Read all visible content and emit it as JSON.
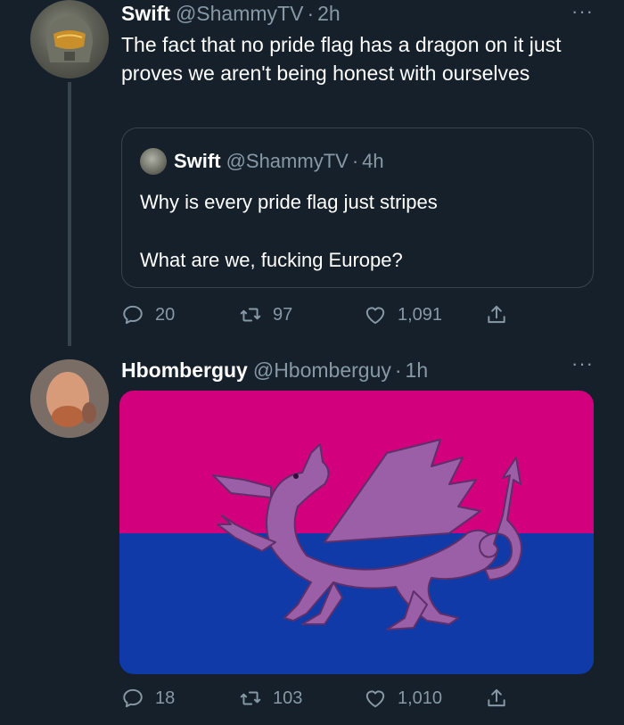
{
  "colors": {
    "background": "#15202b",
    "text": "#ffffff",
    "muted": "#8899a6",
    "border": "#38444d",
    "flag_pink": "#d3007e",
    "flag_blue": "#0f3aa8",
    "dragon_purple": "#9b5fa8"
  },
  "tweet1": {
    "name": "Swift",
    "handle": "@ShammyTV",
    "separator": "·",
    "time": "2h",
    "more": "···",
    "text": "The fact that no pride flag has a dragon on it just proves we aren't being honest with ourselves",
    "quote": {
      "name": "Swift",
      "handle": "@ShammyTV",
      "separator": "·",
      "time": "4h",
      "line1": "Why is every pride flag just stripes",
      "line2": "What are we, fucking Europe?"
    },
    "actions": {
      "replies": "20",
      "retweets": "97",
      "likes": "1,091"
    }
  },
  "tweet2": {
    "name": "Hbomberguy",
    "handle": "@Hbomberguy",
    "separator": "·",
    "time": "1h",
    "more": "···",
    "actions": {
      "replies": "18",
      "retweets": "103",
      "likes": "1,010"
    }
  },
  "icons": [
    "reply-icon",
    "retweet-icon",
    "like-icon",
    "share-icon",
    "more-icon"
  ]
}
